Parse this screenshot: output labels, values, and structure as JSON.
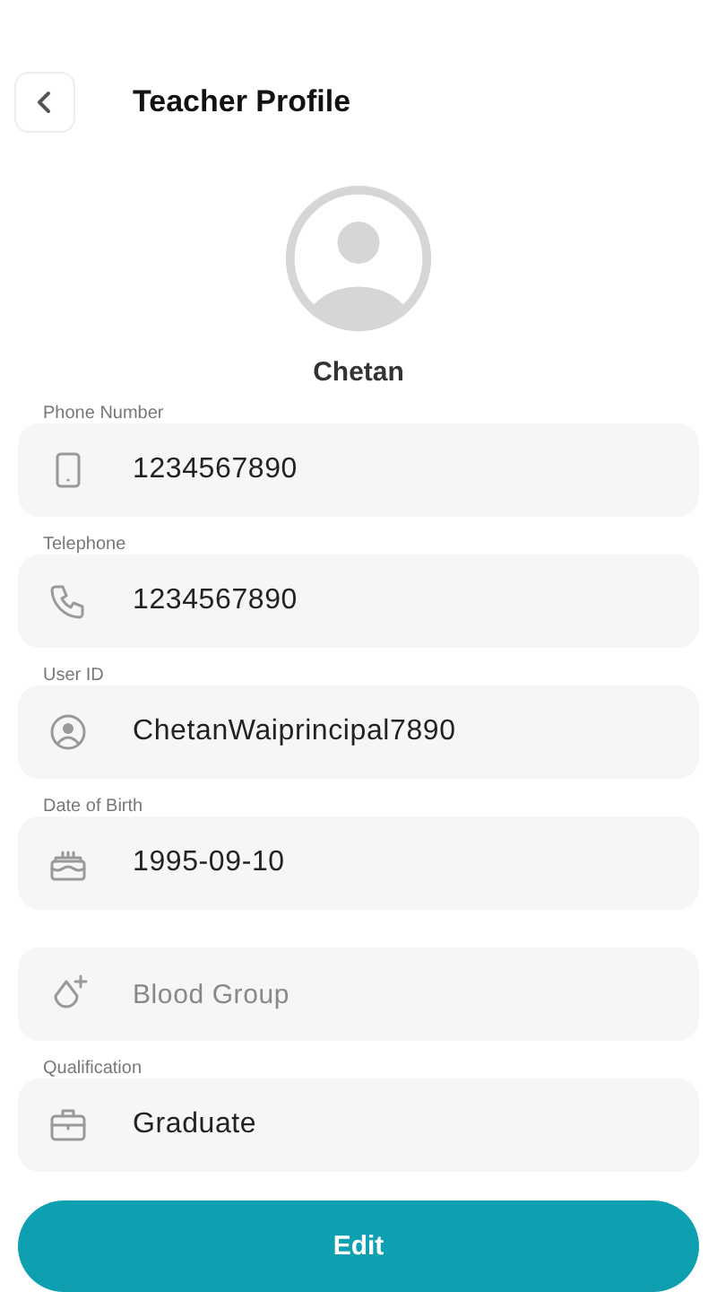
{
  "header": {
    "title": "Teacher Profile"
  },
  "profile": {
    "name": "Chetan"
  },
  "fields": [
    {
      "label": "Phone Number",
      "kind": "mobile",
      "value": "1234567890"
    },
    {
      "label": "Telephone",
      "kind": "phone",
      "value": "1234567890"
    },
    {
      "label": "User ID",
      "kind": "user",
      "value": "ChetanWaiprincipal7890"
    },
    {
      "label": "Date of Birth",
      "kind": "cake",
      "value": "1995-09-10"
    },
    {
      "kind": "drop",
      "placeholder": "Blood Group"
    },
    {
      "label": "Qualification",
      "kind": "briefcase",
      "value": "Graduate"
    }
  ],
  "button": "Edit"
}
